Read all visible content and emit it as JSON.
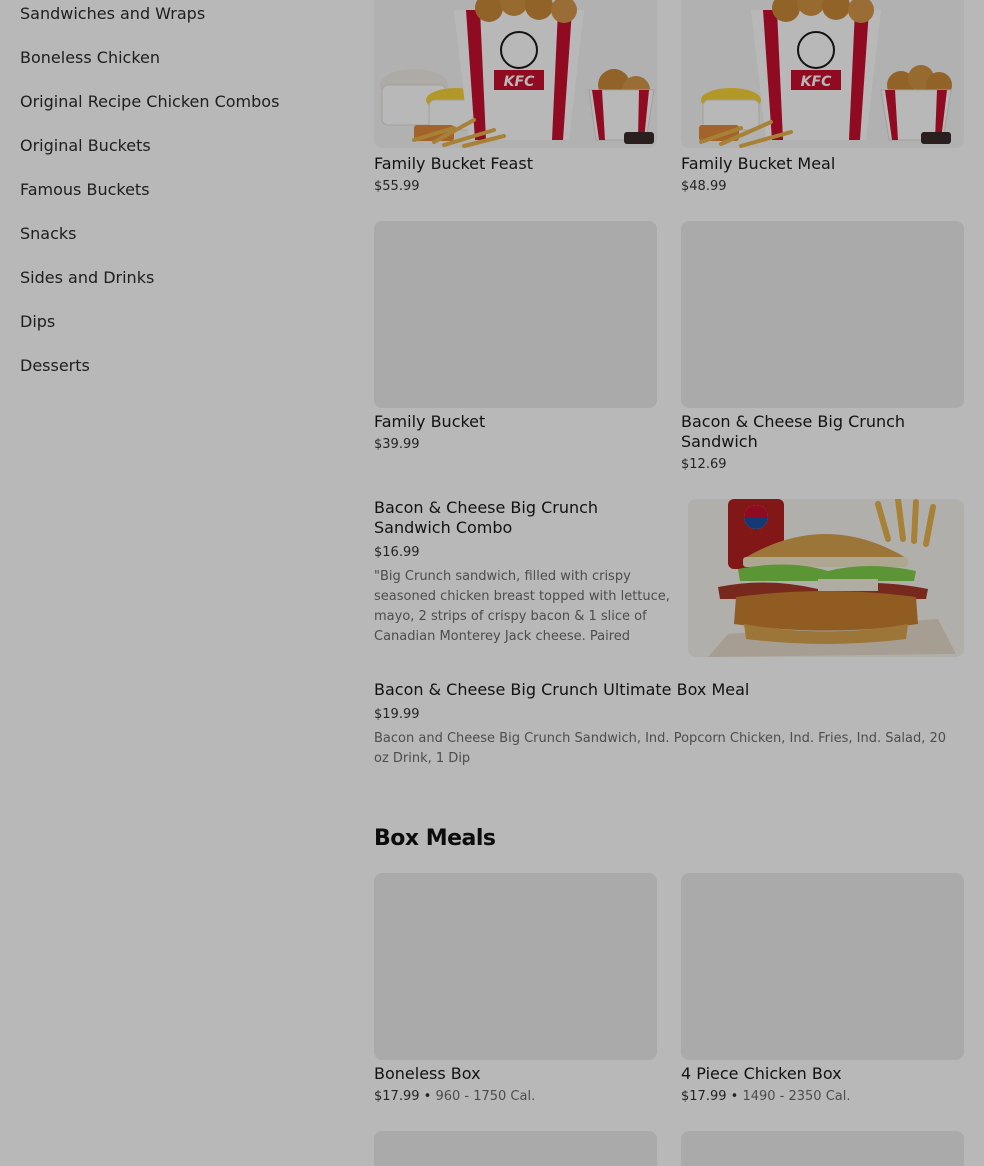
{
  "sidebar": {
    "items": [
      {
        "label": "Sandwiches and Wraps"
      },
      {
        "label": "Boneless Chicken"
      },
      {
        "label": "Original Recipe Chicken Combos"
      },
      {
        "label": "Original Buckets"
      },
      {
        "label": "Famous Buckets"
      },
      {
        "label": "Snacks"
      },
      {
        "label": "Sides and Drinks"
      },
      {
        "label": "Dips"
      },
      {
        "label": "Desserts"
      }
    ]
  },
  "menu": {
    "items": [
      {
        "title": "Family Bucket Feast",
        "price": "$55.99"
      },
      {
        "title": "Family Bucket Meal",
        "price": "$48.99"
      },
      {
        "title": "Family Bucket",
        "price": "$39.99"
      },
      {
        "title": "Bacon & Cheese Big Crunch Sandwich",
        "price": "$12.69"
      },
      {
        "title": "Bacon & Cheese Big Crunch Sandwich Combo",
        "price": "$16.99",
        "description": "\"Big Crunch sandwich, filled with crispy seasoned chicken breast topped with lettuce, mayo, 2 strips of crispy bacon & 1 slice of Canadian Monterey Jack cheese. Paired with…"
      },
      {
        "title": "Bacon & Cheese Big Crunch Ultimate Box Meal",
        "price": "$19.99",
        "description": "Bacon and Cheese Big Crunch Sandwich, Ind. Popcorn Chicken, Ind. Fries, Ind. Salad, 20 oz Drink, 1 Dip"
      }
    ]
  },
  "box_meals": {
    "heading": "Box Meals",
    "items": [
      {
        "title": "Boneless Box",
        "price": "$17.99",
        "separator": " • ",
        "calories": "960 - 1750 Cal."
      },
      {
        "title": "4 Piece Chicken Box",
        "price": "$17.99",
        "separator": " • ",
        "calories": "1490 - 2350 Cal."
      }
    ]
  },
  "image_labels": {
    "brand": "KFC"
  },
  "colors": {
    "kfc_red": "#c8102e",
    "placeholder": "#ececec",
    "overlay": "rgba(0,0,0,0.28)"
  }
}
